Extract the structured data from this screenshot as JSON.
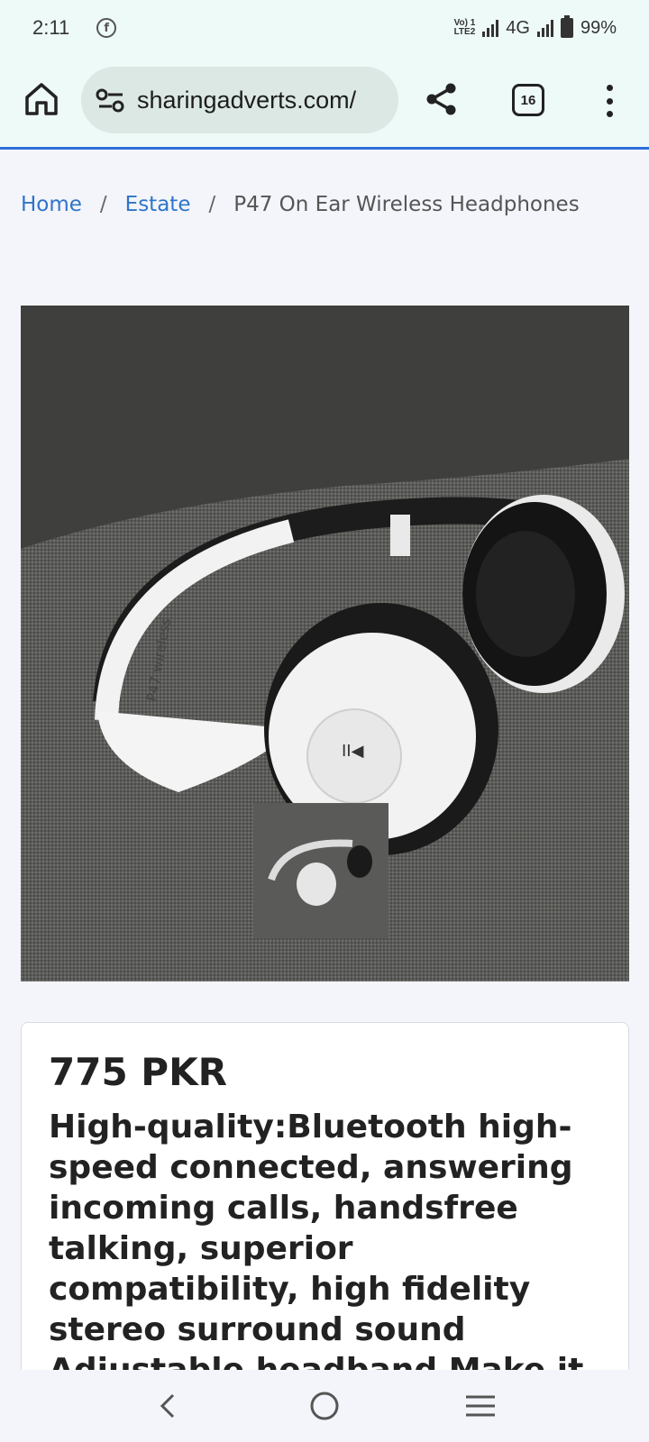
{
  "status_bar": {
    "time": "2:11",
    "network_type": "4G",
    "battery": "99%",
    "volte_line1": "Vo) 1",
    "volte_line2": "LTE2"
  },
  "browser": {
    "url": "sharingadverts.com/",
    "tab_count": "16"
  },
  "breadcrumb": {
    "items": [
      {
        "label": "Home"
      },
      {
        "label": "Estate"
      }
    ],
    "separator": "/",
    "current": "P47 On Ear Wireless Headphones"
  },
  "product": {
    "image_icon": "headphones-photo",
    "price": "775 PKR",
    "description": "High-quality:Bluetooth high-speed connected, answering incoming calls, handsfree talking, superior compatibility, high fidelity stereo surround sound Adjustable headband Make it easy to take"
  },
  "colors": {
    "accent": "#2f6fdc",
    "link": "#2f74c9"
  }
}
